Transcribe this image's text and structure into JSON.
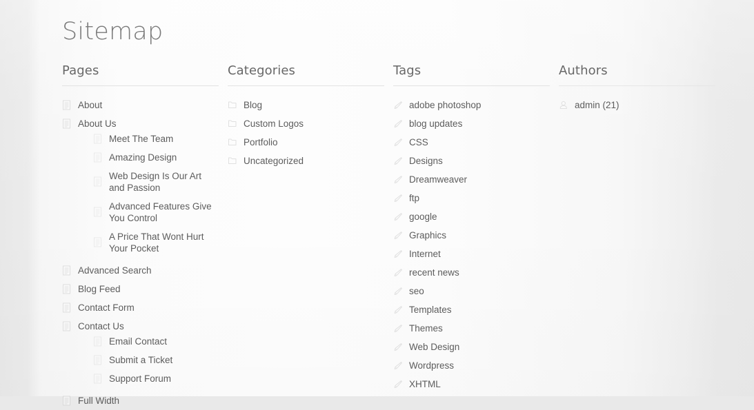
{
  "page": {
    "title": "Sitemap",
    "background_center": "#fcfcfc",
    "background_edge": "#e9e9e9",
    "text_color": "#5c5c5c",
    "heading_color": "#7a7a7a"
  },
  "columns": {
    "pages": {
      "heading": "Pages",
      "icon": "page-icon",
      "items": [
        {
          "label": "About",
          "children": []
        },
        {
          "label": "About Us",
          "children": [
            {
              "label": "Meet The Team"
            },
            {
              "label": "Amazing Design"
            },
            {
              "label": "Web Design Is Our Art and Passion"
            },
            {
              "label": "Advanced Features Give You Control"
            },
            {
              "label": "A Price That Wont Hurt Your Pocket"
            }
          ]
        },
        {
          "label": "Advanced Search",
          "children": []
        },
        {
          "label": "Blog Feed",
          "children": []
        },
        {
          "label": "Contact Form",
          "children": []
        },
        {
          "label": "Contact Us",
          "children": [
            {
              "label": "Email Contact"
            },
            {
              "label": "Submit a Ticket"
            },
            {
              "label": "Support Forum"
            }
          ]
        },
        {
          "label": "Full Width",
          "children": []
        }
      ]
    },
    "categories": {
      "heading": "Categories",
      "icon": "folder-icon",
      "items": [
        {
          "label": "Blog"
        },
        {
          "label": "Custom Logos"
        },
        {
          "label": "Portfolio"
        },
        {
          "label": "Uncategorized"
        }
      ]
    },
    "tags": {
      "heading": "Tags",
      "icon": "tag-pencil-icon",
      "items": [
        {
          "label": "adobe photoshop"
        },
        {
          "label": "blog updates"
        },
        {
          "label": "CSS"
        },
        {
          "label": "Designs"
        },
        {
          "label": "Dreamweaver"
        },
        {
          "label": "ftp"
        },
        {
          "label": "google"
        },
        {
          "label": "Graphics"
        },
        {
          "label": "Internet"
        },
        {
          "label": "recent news"
        },
        {
          "label": "seo"
        },
        {
          "label": "Templates"
        },
        {
          "label": "Themes"
        },
        {
          "label": "Web Design"
        },
        {
          "label": "Wordpress"
        },
        {
          "label": "XHTML"
        }
      ]
    },
    "authors": {
      "heading": "Authors",
      "icon": "user-icon",
      "items": [
        {
          "label": "admin (21)"
        }
      ]
    }
  }
}
